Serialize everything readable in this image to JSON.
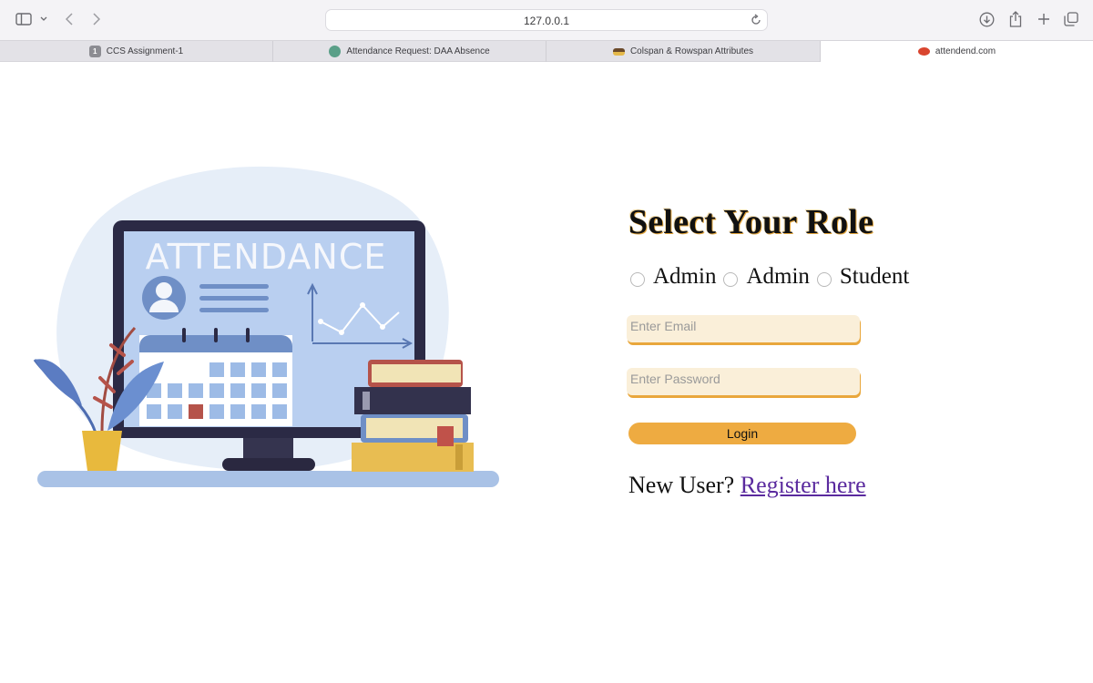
{
  "browser": {
    "url": "127.0.0.1",
    "tabs": [
      {
        "label": "CCS Assignment-1",
        "favicon_text": "1"
      },
      {
        "label": "Attendance Request: DAA Absence"
      },
      {
        "label": "Colspan & Rowspan Attributes"
      },
      {
        "label": "attendend.com"
      }
    ]
  },
  "illustration": {
    "screen_text": "ATTENDANCE"
  },
  "login": {
    "title": "Select Your Role",
    "roles": [
      "Admin",
      "Admin",
      "Student"
    ],
    "email_placeholder": "Enter Email",
    "password_placeholder": "Enter Password",
    "login_label": "Login",
    "new_user_text": "New User?",
    "register_link": "Register here"
  },
  "colors": {
    "accent": "#eeab41",
    "input_bg": "#faefd9",
    "link": "#5a2a9e"
  }
}
